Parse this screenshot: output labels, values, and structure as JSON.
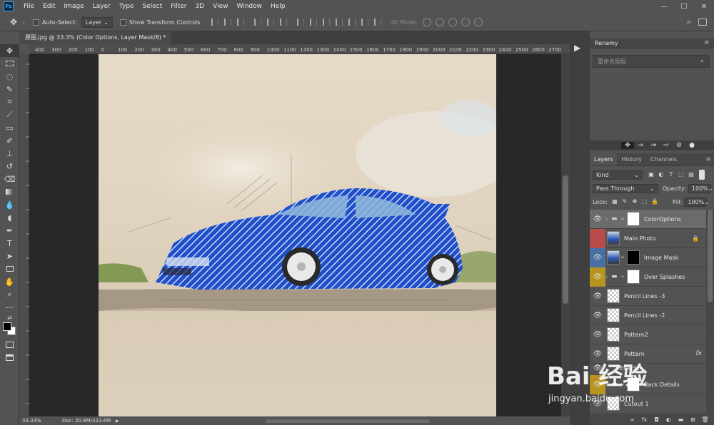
{
  "app": {
    "logo": "Ps"
  },
  "menubar": {
    "items": [
      "File",
      "Edit",
      "Image",
      "Layer",
      "Type",
      "Select",
      "Filter",
      "3D",
      "View",
      "Window",
      "Help"
    ]
  },
  "window_controls": {
    "minimize": "—",
    "maximize": "☐",
    "close": "✕"
  },
  "options_bar": {
    "auto_select_label": "Auto-Select:",
    "auto_select_value": "Layer",
    "transform_label": "Show Transform Controls",
    "mode_3d_label": "3D Mode:"
  },
  "document": {
    "tab_title": "原图.jpg @ 33.3% (Color Options, Layer Mask/8) *",
    "zoom": "33.33%",
    "doc_size": "Doc: 20.6M/323.6M"
  },
  "ruler": {
    "marks": [
      "400",
      "300",
      "200",
      "100",
      "0",
      "100",
      "200",
      "300",
      "400",
      "500",
      "600",
      "700",
      "800",
      "900",
      "1000",
      "1100",
      "1200",
      "1300",
      "1400",
      "1500",
      "1600",
      "1700",
      "1800",
      "1900",
      "2000",
      "2100",
      "2200",
      "2300",
      "2400",
      "2500",
      "2600",
      "2700"
    ]
  },
  "tools": [
    "move-tool",
    "marquee-tool",
    "lasso-tool",
    "quick-select-tool",
    "crop-tool",
    "eyedropper-tool",
    "healing-tool",
    "brush-tool",
    "stamp-tool",
    "history-brush-tool",
    "eraser-tool",
    "gradient-tool",
    "blur-tool",
    "dodge-tool",
    "pen-tool",
    "type-tool",
    "path-select-tool",
    "shape-tool",
    "hand-tool",
    "zoom-tool",
    "more-tools"
  ],
  "renamy": {
    "title": "Renamy",
    "placeholder": "重命名图层"
  },
  "panel_tabs": [
    {
      "label": "Layers"
    },
    {
      "label": "History"
    },
    {
      "label": "Channels"
    }
  ],
  "layers_panel": {
    "filter_kind": "Kind",
    "blend_mode": "Pass Through",
    "opacity_label": "Opacity:",
    "opacity_value": "100%",
    "lock_label": "Lock:",
    "fill_label": "Fill:",
    "fill_value": "100%"
  },
  "layers": [
    {
      "name": "ColorOptions",
      "eye_color": "#535353",
      "selected": true
    },
    {
      "name": "Main Photo",
      "eye_color": "#b84a4a",
      "locked": true
    },
    {
      "name": "Image Mask",
      "eye_color": "#4a6fa5"
    },
    {
      "name": "Over Splashes",
      "eye_color": "#b8941f"
    },
    {
      "name": "Pencil Lines -3",
      "eye_color": "#535353"
    },
    {
      "name": "Pencil Lines -2",
      "eye_color": "#535353"
    },
    {
      "name": "Pattern2",
      "eye_color": "#535353"
    },
    {
      "name": "Pattern",
      "eye_color": "#535353",
      "fx": "fx"
    },
    {
      "name": "Effects",
      "eye_color": "#535353"
    },
    {
      "name": "Back Details",
      "eye_color": "#b8941f"
    },
    {
      "name": "Cutout 1",
      "eye_color": "#535353"
    }
  ],
  "watermark": {
    "logo_text": "Bai 经验",
    "url": "jingyan.baidu.com"
  }
}
